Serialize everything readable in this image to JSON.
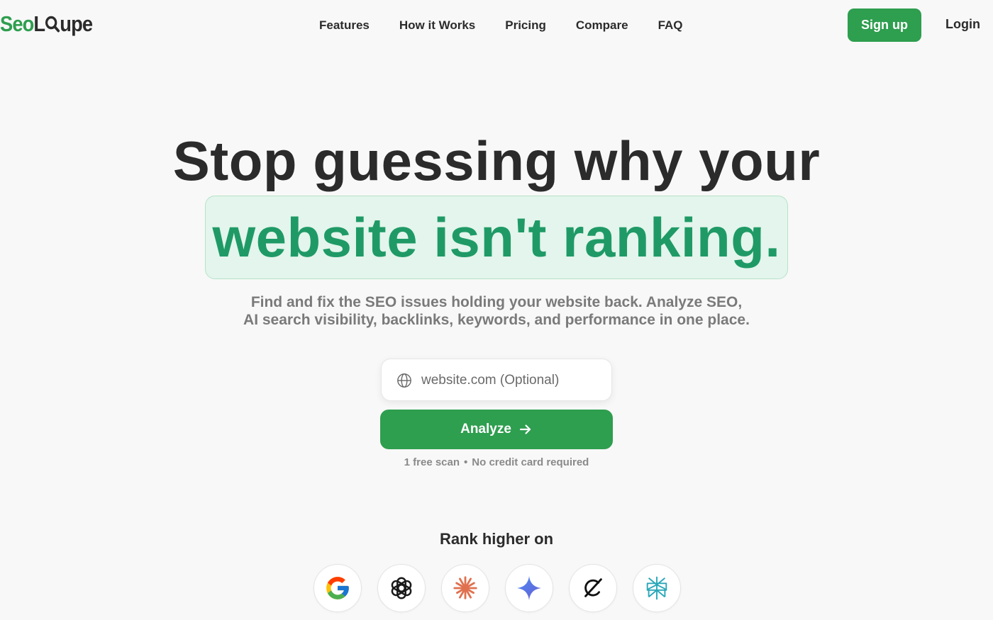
{
  "brand": {
    "logo_part1": "Seo",
    "logo_part2_before_lens": "L",
    "logo_part2_after_lens": "upe",
    "primary_color": "#2e9e4f",
    "highlight_color": "#1f9a66"
  },
  "nav": {
    "links": [
      {
        "label": "Features"
      },
      {
        "label": "How it Works"
      },
      {
        "label": "Pricing"
      },
      {
        "label": "Compare"
      },
      {
        "label": "FAQ"
      }
    ],
    "signup_label": "Sign up",
    "login_label": "Login"
  },
  "hero": {
    "headline_line1": "Stop guessing why your",
    "headline_line2": "website isn't ranking.",
    "subtext_line1": "Find and fix the SEO issues holding your website back. Analyze SEO,",
    "subtext_line2": "AI search visibility, backlinks, keywords, and performance in one place."
  },
  "form": {
    "url_placeholder": "website.com (Optional)",
    "url_value": "",
    "globe_icon": "globe-icon",
    "analyze_label": "Analyze",
    "analyze_icon": "arrow-right-icon",
    "fine_print_1": "1 free scan",
    "fine_print_separator": "•",
    "fine_print_2": "No credit card required"
  },
  "rank": {
    "title": "Rank higher on",
    "engines": [
      {
        "icon": "google-icon"
      },
      {
        "icon": "chatgpt-icon"
      },
      {
        "icon": "claude-icon"
      },
      {
        "icon": "gemini-icon"
      },
      {
        "icon": "grok-icon"
      },
      {
        "icon": "perplexity-icon"
      }
    ]
  }
}
